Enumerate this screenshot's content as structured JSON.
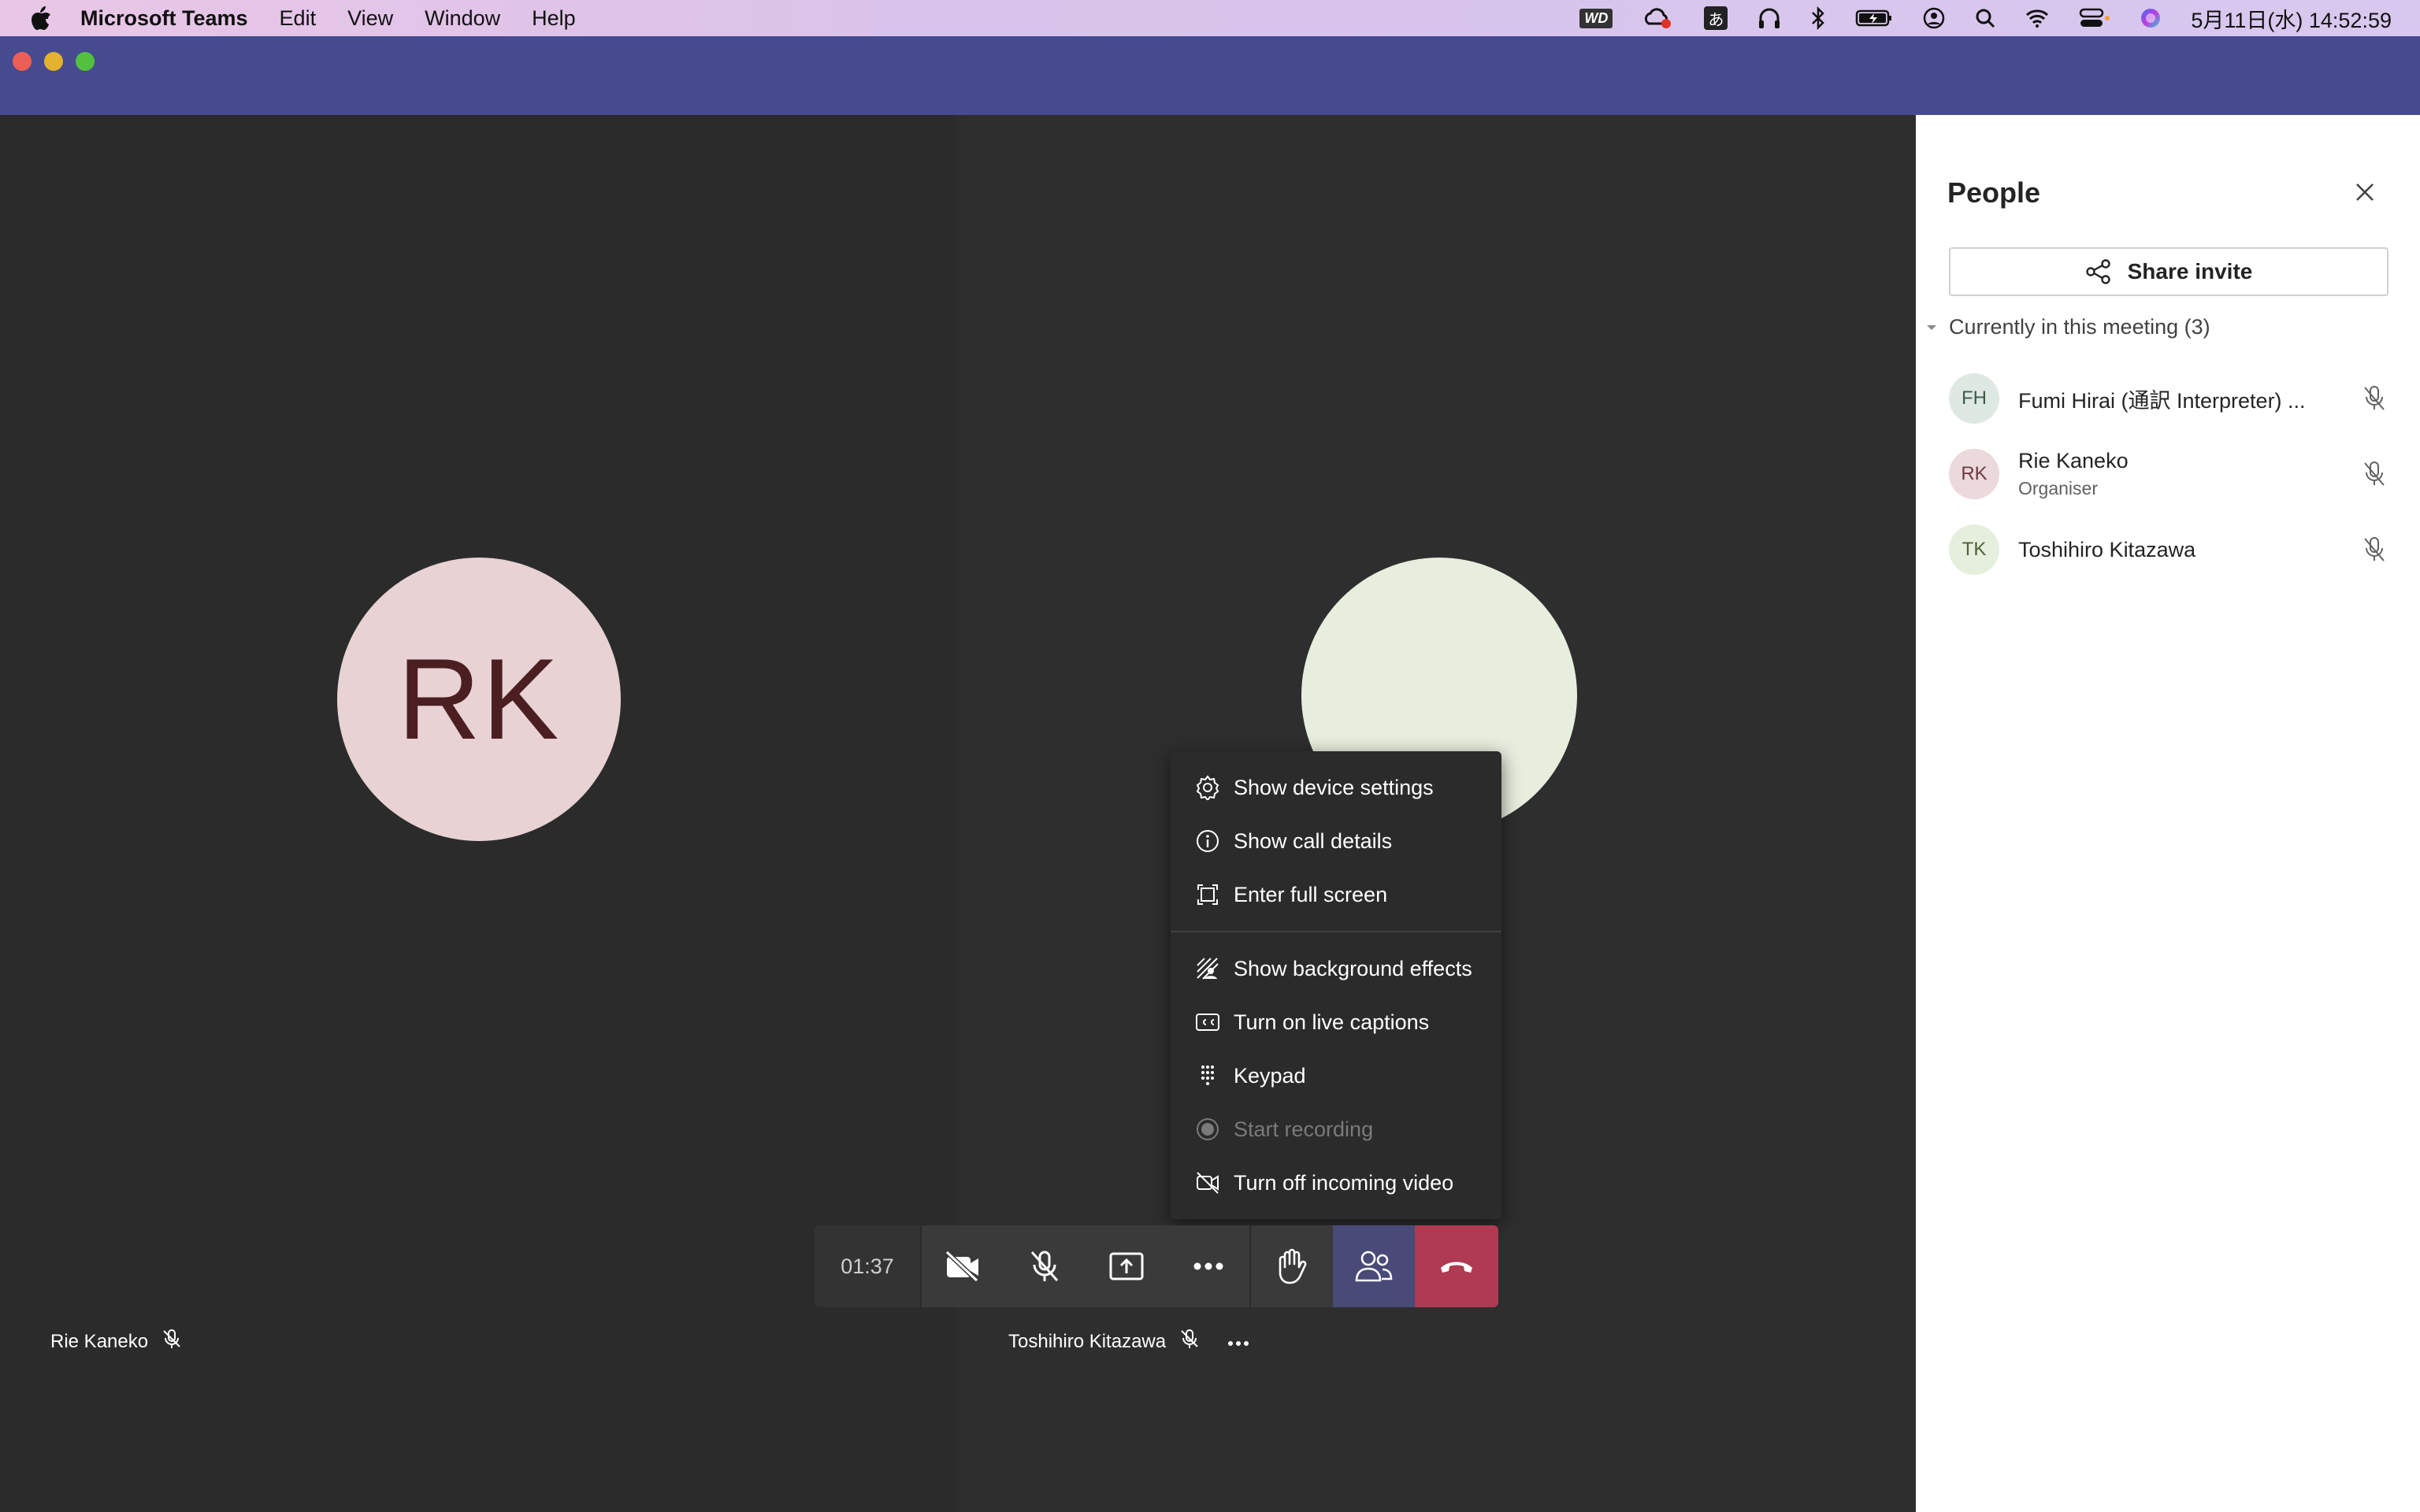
{
  "menubar": {
    "app_name": "Microsoft Teams",
    "items": [
      "Edit",
      "View",
      "Window",
      "Help"
    ],
    "clock": "5月11日(水)  14:52:59",
    "wd_label": "WD",
    "ime_label": "あ"
  },
  "call": {
    "timer": "01:37",
    "participants": [
      {
        "initials": "RK",
        "name": "Rie Kaneko",
        "avatar_color": "#e8d2d4",
        "text_color": "#4b1f22"
      },
      {
        "name": "Toshihiro Kitazawa",
        "avatar_color": "#e7eede"
      }
    ]
  },
  "more_menu": {
    "items": [
      {
        "label": "Show device settings",
        "icon": "gear-icon"
      },
      {
        "label": "Show call details",
        "icon": "info-icon"
      },
      {
        "label": "Enter full screen",
        "icon": "fullscreen-icon"
      },
      {
        "label": "Show background effects",
        "icon": "background-effects-icon"
      },
      {
        "label": "Turn on live captions",
        "icon": "captions-icon"
      },
      {
        "label": "Keypad",
        "icon": "keypad-icon"
      },
      {
        "label": "Start recording",
        "icon": "record-icon",
        "disabled": true
      },
      {
        "label": "Turn off incoming video",
        "icon": "video-off-icon"
      }
    ]
  },
  "people_panel": {
    "title": "People",
    "share_label": "Share invite",
    "section_label": "Currently in this meeting (3)",
    "people": [
      {
        "initials": "FH",
        "name": "Fumi Hirai (通訳 Interpreter) ...",
        "role": "",
        "avatar_bg": "#dfe9e3",
        "avatar_fg": "#3c5c48"
      },
      {
        "initials": "RK",
        "name": "Rie Kaneko",
        "role": "Organiser",
        "avatar_bg": "#ecd9dc",
        "avatar_fg": "#6b3a40"
      },
      {
        "initials": "TK",
        "name": "Toshihiro Kitazawa",
        "role": "",
        "avatar_bg": "#e6eedd",
        "avatar_fg": "#4f6136"
      }
    ]
  },
  "colors": {
    "titlebar": "#464a8f",
    "hangup": "#b03a51",
    "people_active": "#484a78"
  }
}
